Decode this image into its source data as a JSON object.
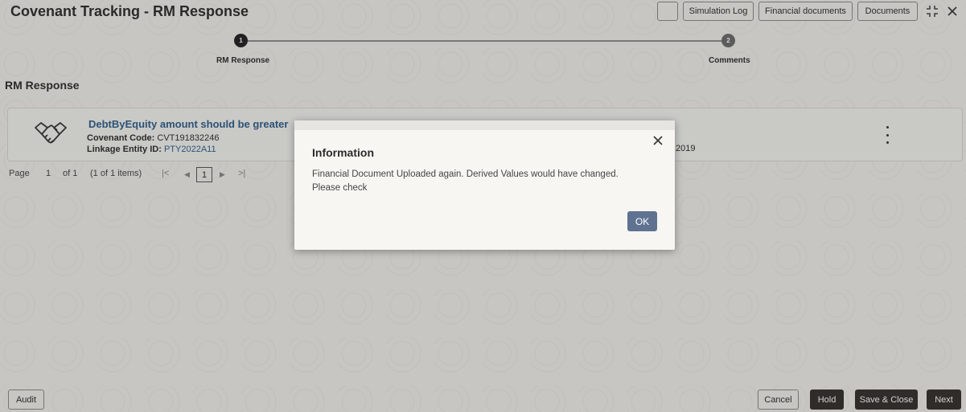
{
  "header": {
    "title": "Covenant Tracking - RM Response",
    "buttons": {
      "simulation_log": "Simulation Log",
      "financial_documents": "Financial documents",
      "documents": "Documents"
    },
    "icons": [
      "blank-square",
      "collapse-icon",
      "close-icon"
    ]
  },
  "stepper": {
    "steps": [
      {
        "number": "1",
        "label": "RM Response"
      },
      {
        "number": "2",
        "label": "Comments"
      }
    ]
  },
  "section_title": "RM Response",
  "card": {
    "title": "DebtByEquity amount should be greater",
    "covenant_code_label": "Covenant Code:",
    "covenant_code": "CVT191832246",
    "linkage_label": "Linkage Entity ID:",
    "linkage_id": "PTY2022A11",
    "date_fragment": "2019"
  },
  "pager": {
    "page_label": "Page",
    "page_num": "1",
    "of_label": "of 1",
    "items_label": "(1 of 1 items)",
    "current": "1"
  },
  "dialog": {
    "title": "Information",
    "message": "Financial Document Uploaded again. Derived Values would have changed. Please check",
    "ok_label": "OK"
  },
  "footer": {
    "audit": "Audit",
    "cancel": "Cancel",
    "hold": "Hold",
    "save_close": "Save & Close",
    "next": "Next"
  },
  "colors": {
    "accent": "#2e5e8c",
    "ok_button": "#5f7391",
    "dark_button": "#312d2a"
  }
}
